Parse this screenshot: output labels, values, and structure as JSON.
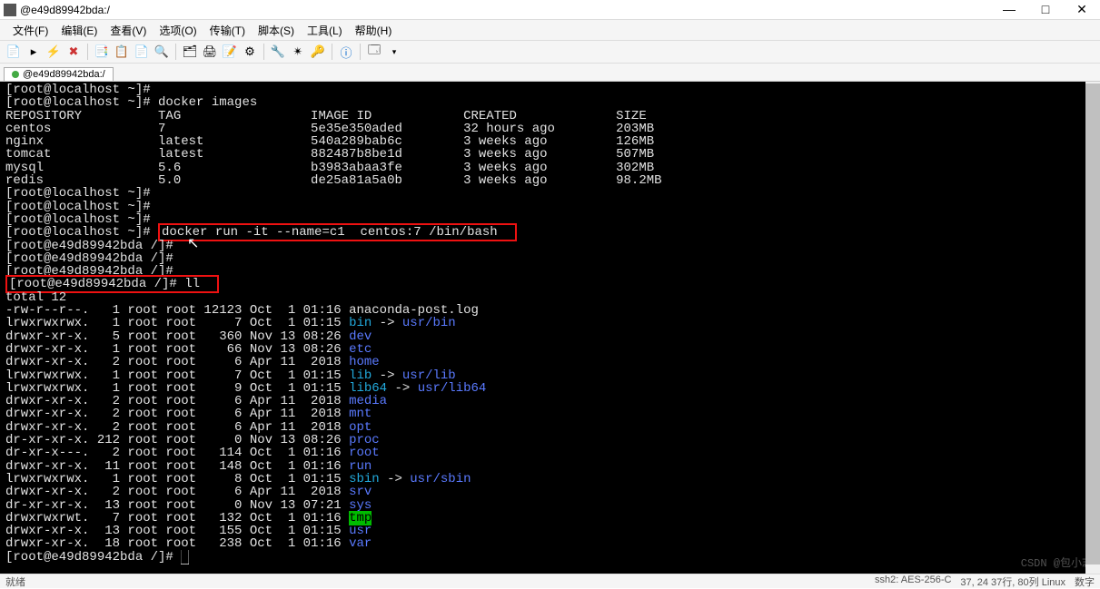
{
  "window": {
    "title": "@e49d89942bda:/"
  },
  "winctrls": {
    "min": "—",
    "max": "□",
    "close": "✕"
  },
  "menu": [
    "文件(F)",
    "编辑(E)",
    "查看(V)",
    "选项(O)",
    "传输(T)",
    "脚本(S)",
    "工具(L)",
    "帮助(H)"
  ],
  "tab": {
    "label": "@e49d89942bda:/"
  },
  "prompts": {
    "local1": "[root@localhost ~]#",
    "local2": "[root@localhost ~]# ",
    "container": "[root@e49d89942bda /]#",
    "container_sp": "[root@e49d89942bda /]# "
  },
  "cmds": {
    "images": "docker images",
    "run": "docker run -it --name=c1  centos:7 /bin/bash",
    "ll": "ll"
  },
  "table_header": "REPOSITORY          TAG                 IMAGE ID            CREATED             SIZE",
  "images_rows": [
    "centos              7                   5e35e350aded        32 hours ago        203MB",
    "nginx               latest              540a289bab6c        3 weeks ago         126MB",
    "tomcat              latest              882487b8be1d        3 weeks ago         507MB",
    "mysql               5.6                 b3983abaa3fe        3 weeks ago         302MB",
    "redis               5.0                 de25a81a5a0b        3 weeks ago         98.2MB"
  ],
  "total": "total 12",
  "ll_rows": [
    {
      "perm": "-rw-r--r--.   1 root root 12123 Oct  1 01:16 ",
      "name": "anaconda-post.log",
      "cls": ""
    },
    {
      "perm": "lrwxrwxrwx.   1 root root     7 Oct  1 01:15 ",
      "name": "bin",
      "cls": "cyan",
      "arrow": " -> ",
      "tgt": "usr/bin",
      "tcls": "blue"
    },
    {
      "perm": "drwxr-xr-x.   5 root root   360 Nov 13 08:26 ",
      "name": "dev",
      "cls": "blue"
    },
    {
      "perm": "drwxr-xr-x.   1 root root    66 Nov 13 08:26 ",
      "name": "etc",
      "cls": "blue"
    },
    {
      "perm": "drwxr-xr-x.   2 root root     6 Apr 11  2018 ",
      "name": "home",
      "cls": "blue"
    },
    {
      "perm": "lrwxrwxrwx.   1 root root     7 Oct  1 01:15 ",
      "name": "lib",
      "cls": "cyan",
      "arrow": " -> ",
      "tgt": "usr/lib",
      "tcls": "blue"
    },
    {
      "perm": "lrwxrwxrwx.   1 root root     9 Oct  1 01:15 ",
      "name": "lib64",
      "cls": "cyan",
      "arrow": " -> ",
      "tgt": "usr/lib64",
      "tcls": "blue"
    },
    {
      "perm": "drwxr-xr-x.   2 root root     6 Apr 11  2018 ",
      "name": "media",
      "cls": "blue"
    },
    {
      "perm": "drwxr-xr-x.   2 root root     6 Apr 11  2018 ",
      "name": "mnt",
      "cls": "blue"
    },
    {
      "perm": "drwxr-xr-x.   2 root root     6 Apr 11  2018 ",
      "name": "opt",
      "cls": "blue"
    },
    {
      "perm": "dr-xr-xr-x. 212 root root     0 Nov 13 08:26 ",
      "name": "proc",
      "cls": "blue"
    },
    {
      "perm": "dr-xr-x---.   2 root root   114 Oct  1 01:16 ",
      "name": "root",
      "cls": "blue"
    },
    {
      "perm": "drwxr-xr-x.  11 root root   148 Oct  1 01:16 ",
      "name": "run",
      "cls": "blue"
    },
    {
      "perm": "lrwxrwxrwx.   1 root root     8 Oct  1 01:15 ",
      "name": "sbin",
      "cls": "cyan",
      "arrow": " -> ",
      "tgt": "usr/sbin",
      "tcls": "blue"
    },
    {
      "perm": "drwxr-xr-x.   2 root root     6 Apr 11  2018 ",
      "name": "srv",
      "cls": "blue"
    },
    {
      "perm": "dr-xr-xr-x.  13 root root     0 Nov 13 07:21 ",
      "name": "sys",
      "cls": "blue"
    },
    {
      "perm": "drwxrwxrwt.   7 root root   132 Oct  1 01:16 ",
      "name": "tmp",
      "cls": "green-hl"
    },
    {
      "perm": "drwxr-xr-x.  13 root root   155 Oct  1 01:15 ",
      "name": "usr",
      "cls": "blue"
    },
    {
      "perm": "drwxr-xr-x.  18 root root   238 Oct  1 01:16 ",
      "name": "var",
      "cls": "blue"
    }
  ],
  "cursor_block": "█",
  "watermark": "CSDN @包小志",
  "status": {
    "left": "就绪",
    "right": [
      "ssh2: AES-256-C",
      "37, 24   37行, 80列   Linux",
      "数字"
    ]
  }
}
